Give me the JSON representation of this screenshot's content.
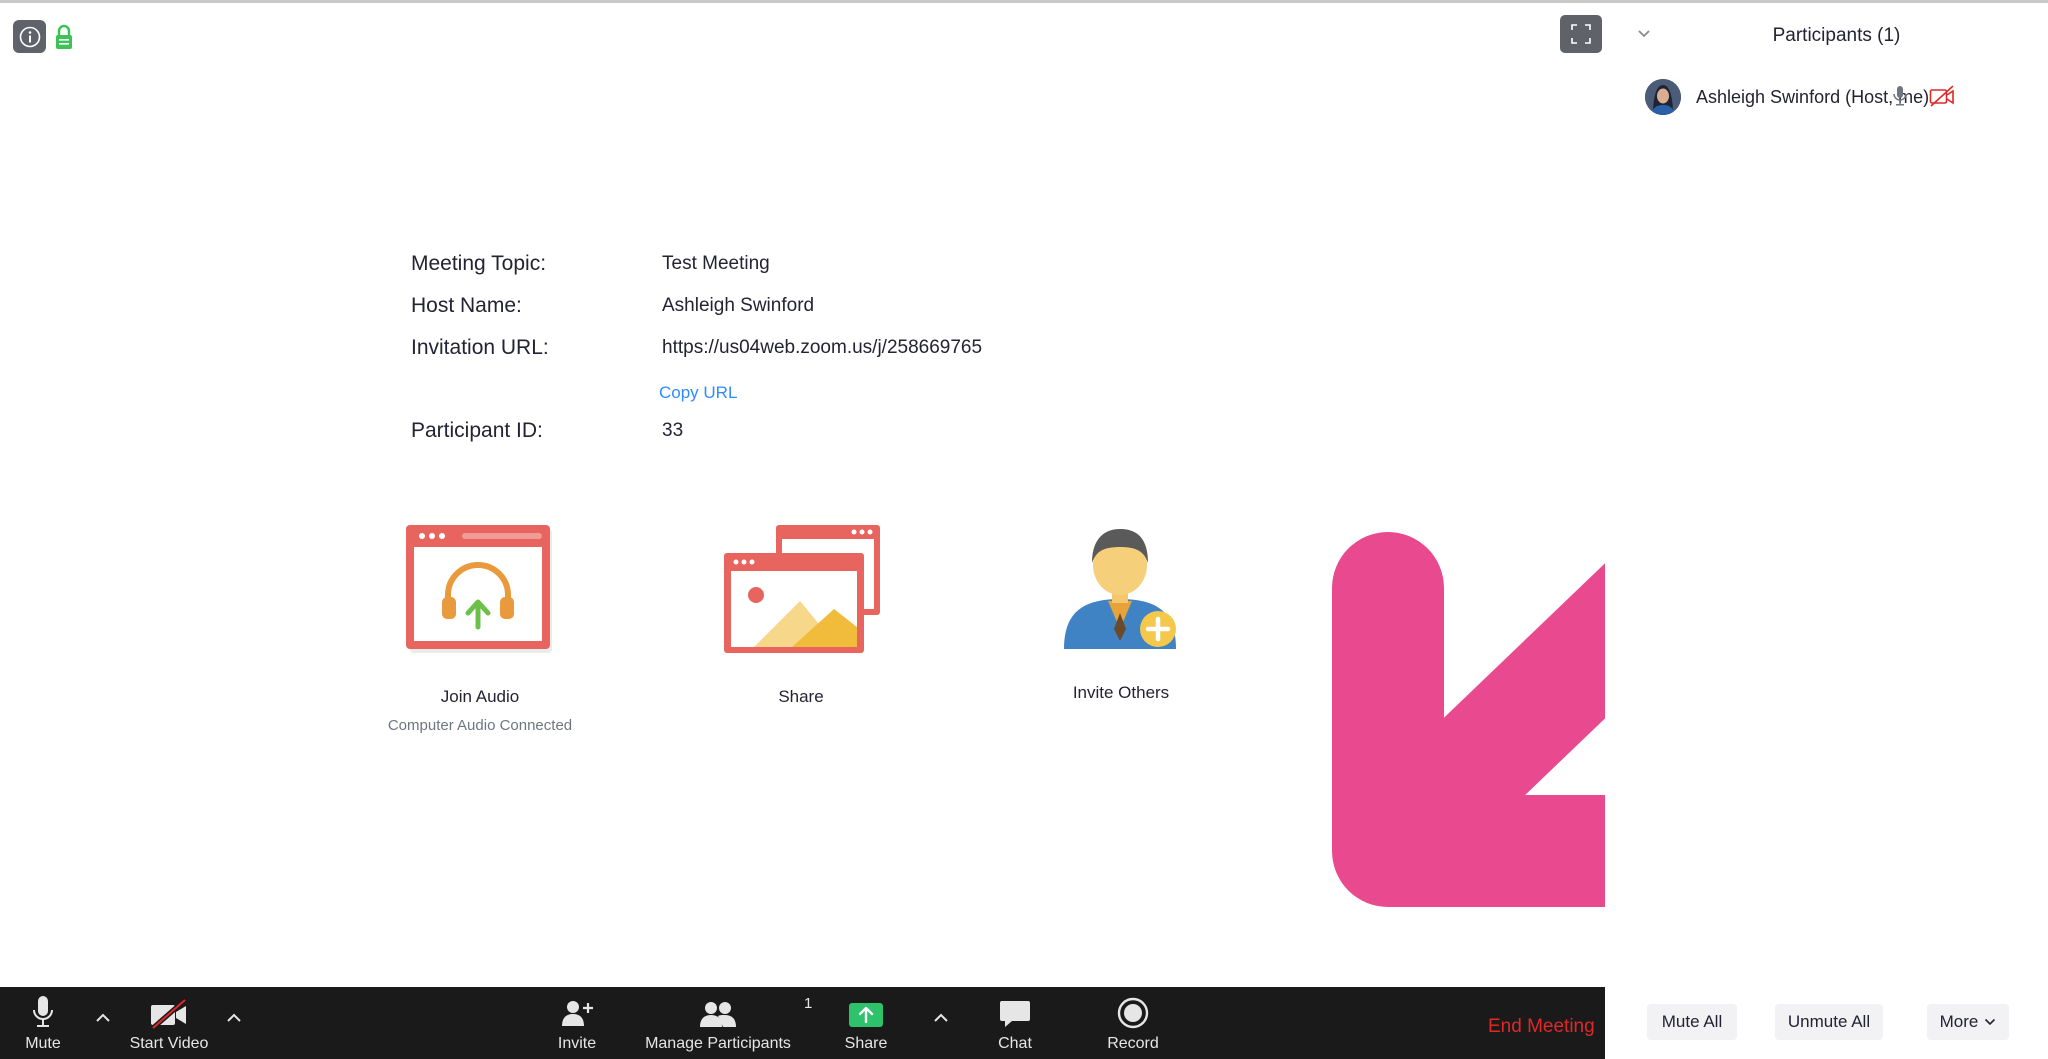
{
  "meeting_info": {
    "topic_label": "Meeting Topic:",
    "topic_value": "Test Meeting",
    "host_label": "Host Name:",
    "host_value": "Ashleigh Swinford",
    "url_label": "Invitation URL:",
    "url_value": "https://us04web.zoom.us/j/258669765",
    "copy_url": "Copy URL",
    "participant_id_label": "Participant ID:",
    "participant_id_value": "33"
  },
  "actions": {
    "join_audio": {
      "label": "Join Audio",
      "sublabel": "Computer Audio Connected",
      "icon": "headphones-upload-icon"
    },
    "share": {
      "label": "Share",
      "icon": "share-screen-icon"
    },
    "invite": {
      "label": "Invite Others",
      "icon": "invite-person-icon"
    }
  },
  "toolbar": {
    "mute": "Mute",
    "start_video": "Start Video",
    "invite": "Invite",
    "manage_participants": "Manage Participants",
    "participant_count": "1",
    "share": "Share",
    "chat": "Chat",
    "record": "Record",
    "end_meeting": "End Meeting"
  },
  "panel": {
    "title": "Participants (1)",
    "participants": [
      {
        "name": "Ashleigh Swinford (Host, me)"
      }
    ],
    "mute_all": "Mute All",
    "unmute_all": "Unmute All",
    "more": "More"
  },
  "colors": {
    "toolbar_bg": "#1a1a1a",
    "end_meeting": "#e02828",
    "link": "#2d8cff",
    "arrow_annotation": "#e94a8f",
    "share_green": "#2ec26a",
    "icon_red": "#e8645e"
  }
}
